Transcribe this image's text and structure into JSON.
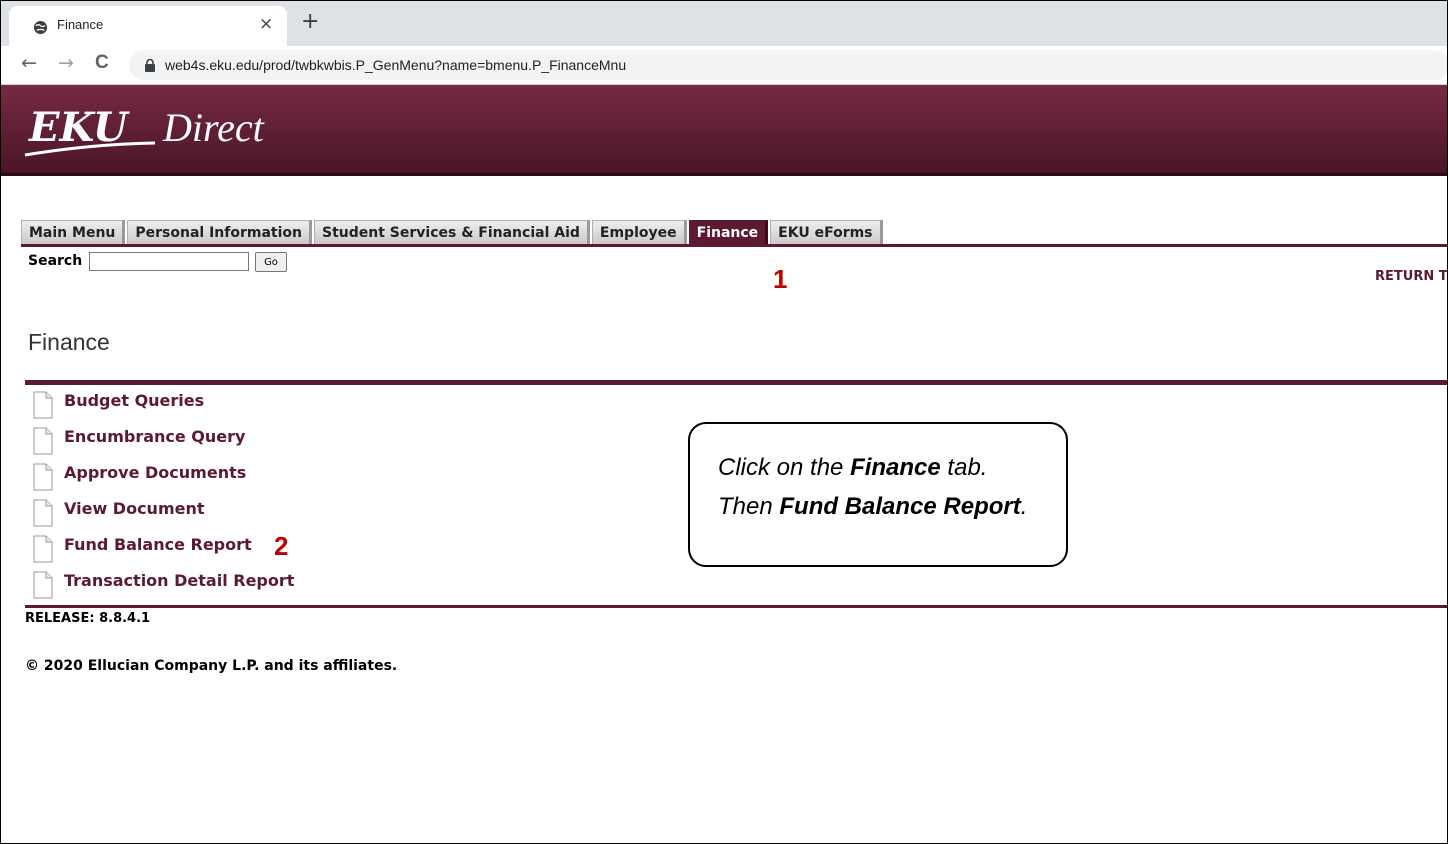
{
  "browser": {
    "tab_title": "Finance",
    "tab_close": "×",
    "new_tab": "+",
    "back": "←",
    "forward": "→",
    "reload": "C",
    "url": "web4s.eku.edu/prod/twbkwbis.P_GenMenu?name=bmenu.P_FinanceMnu"
  },
  "banner": {
    "logo_bold": "EKU",
    "logo_light": "Direct"
  },
  "nav_tabs": [
    {
      "label": "Main Menu",
      "active": false
    },
    {
      "label": "Personal Information",
      "active": false
    },
    {
      "label": "Student Services & Financial Aid",
      "active": false
    },
    {
      "label": "Employee",
      "active": false
    },
    {
      "label": "Finance",
      "active": true
    },
    {
      "label": "EKU eForms",
      "active": false
    }
  ],
  "search": {
    "label": "Search",
    "value": "",
    "go_label": "Go"
  },
  "return_link": "RETURN T",
  "callouts": {
    "step1": "1",
    "step2": "2"
  },
  "page_title": "Finance",
  "menu_items": [
    {
      "label": "Budget Queries"
    },
    {
      "label": "Encumbrance Query"
    },
    {
      "label": "Approve Documents"
    },
    {
      "label": "View Document"
    },
    {
      "label": "Fund Balance Report"
    },
    {
      "label": "Transaction Detail Report"
    }
  ],
  "release": "RELEASE: 8.8.4.1",
  "copyright": "© 2020 Ellucian Company L.P. and its affiliates.",
  "instruction": {
    "line1_pre": "Click on the ",
    "line1_bold": "Finance",
    "line1_post": " tab.",
    "line2_pre": "Then ",
    "line2_bold": "Fund Balance Report",
    "line2_post": "."
  },
  "colors": {
    "maroon": "#5c1a30",
    "banner_top": "#762a44",
    "callout_red": "#c00000"
  }
}
